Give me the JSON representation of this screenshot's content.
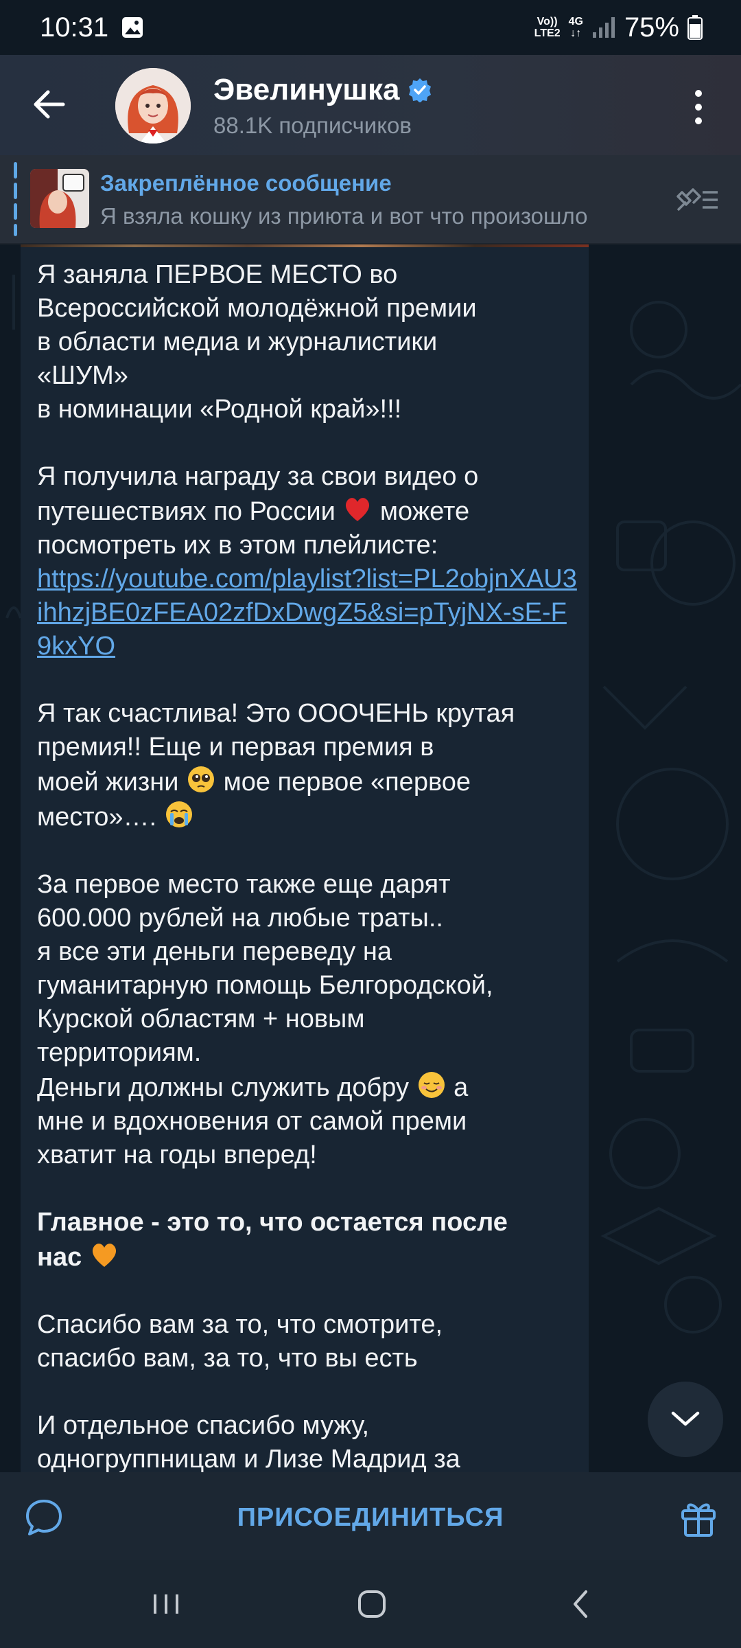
{
  "status_bar": {
    "time": "10:31",
    "network_top": "Vo))",
    "network_bottom": "LTE2",
    "signal_type": "4G",
    "battery": "75%"
  },
  "header": {
    "title": "Эвелинушка",
    "subscribers": "88.1K подписчиков"
  },
  "pinned": {
    "title": "Закреплённое сообщение",
    "text": "Я взяла кошку из приюта и вот что произошло"
  },
  "message": {
    "p1_l1": "Я заняла ПЕРВОЕ МЕСТО во",
    "p1_l2": "Всероссийской молодёжной премии",
    "p1_l3": "в области медиа и журналистики",
    "p1_l4": "«ШУМ»",
    "p1_l5": "в номинации «Родной край»!!!",
    "p2_l1": "Я получила награду за свои видео о",
    "p2_l2a": "путешествиях по России",
    "p2_l2b": "можете",
    "p2_l3": "посмотреть их в этом плейлисте:",
    "link": "https://youtube.com/playlist?list=PL2objnXAU3ihhzjBE0zFEA02zfDxDwgZ5&si=pTyjNX-sE-F9kxYO",
    "p3_l1": "Я так счастлива! Это ОООЧЕНЬ крутая",
    "p3_l2": "премия!! Еще и первая премия в",
    "p3_l3a": "моей жизни",
    "p3_l3b": "мое первое «первое",
    "p3_l4": "место»….",
    "p4_l1": "За первое место также еще дарят",
    "p4_l2": "600.000 рублей на любые траты..",
    "p4_l3": "я все эти деньги переведу на",
    "p4_l4": "гуманитарную помощь Белгородской,",
    "p4_l5": "Курской областям + новым",
    "p4_l6": "территориям.",
    "p4_l7a": "Деньги должны служить добру",
    "p4_l7b": "а",
    "p4_l8": "мне и вдохновения от самой преми",
    "p4_l9": "хватит на годы вперед!",
    "p5_l1": "Главное - это то, что остается после",
    "p5_l2": "нас",
    "p6_l1": "Спасибо вам за то, что смотрите,",
    "p6_l2": "спасибо вам, за то, что вы есть",
    "p7_l1": "И отдельное спасибо мужу,",
    "p7_l2": "одногруппницам и Лизе Мадрид за"
  },
  "join_bar": {
    "join_label": "ПРИСОЕДИНИТЬСЯ"
  },
  "icons": {
    "back": "arrow-left-icon",
    "menu": "more-vertical-icon",
    "verified": "verified-badge-icon",
    "unpin": "unpin-list-icon",
    "comments": "chat-bubble-icon",
    "gift": "gift-icon",
    "scroll_down": "chevron-down-icon"
  },
  "colors": {
    "accent": "#62a8e8",
    "bubble": "#182533",
    "verified": "#4ea4f6"
  }
}
